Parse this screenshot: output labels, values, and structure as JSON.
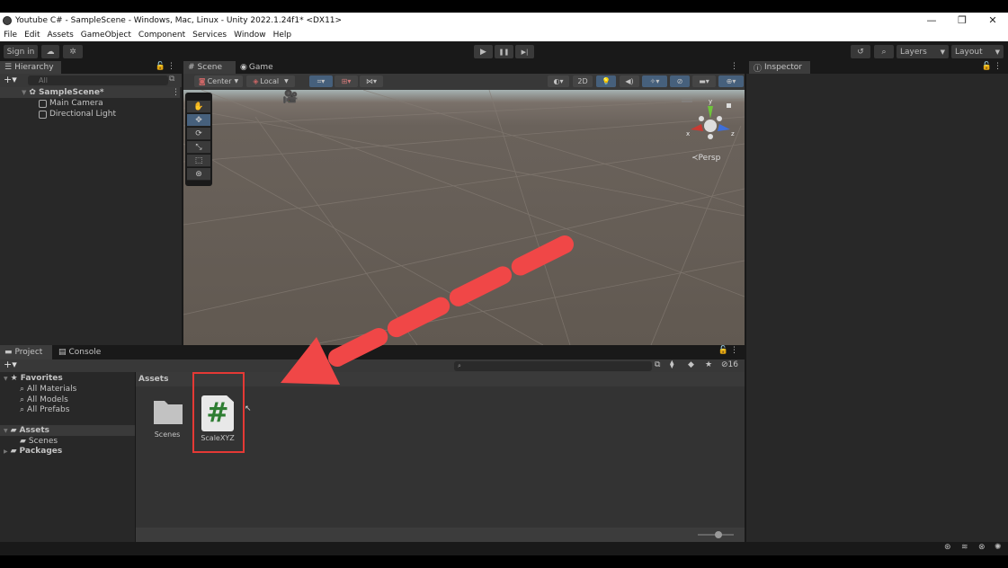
{
  "window": {
    "title": "Youtube C# - SampleScene - Windows, Mac, Linux - Unity 2022.1.24f1* <DX11>",
    "controls": {
      "minimize": "—",
      "maximize": "❐",
      "close": "✕"
    }
  },
  "menu": [
    "File",
    "Edit",
    "Assets",
    "GameObject",
    "Component",
    "Services",
    "Window",
    "Help"
  ],
  "toolbar": {
    "sign_in": "Sign in",
    "cloud_icon": "cloud-icon",
    "collab_icon": "collab-icon",
    "play": "▶",
    "pause": "❚❚",
    "step": "▶|",
    "history_icon": "history-icon",
    "search_icon": "search-icon",
    "layers": "Layers",
    "layout": "Layout"
  },
  "hierarchy": {
    "tab": "Hierarchy",
    "add": "+▾",
    "search_placeholder": "All",
    "scene": "SampleScene*",
    "items": [
      "Main Camera",
      "Directional Light"
    ]
  },
  "scene_view": {
    "tabs": [
      "Scene",
      "Game"
    ],
    "pivot": "Center",
    "space": "Local",
    "mode_2d": "2D",
    "persp": "Persp",
    "gizmo_axes": {
      "x": "x",
      "y": "y",
      "z": "z"
    }
  },
  "inspector": {
    "tab": "Inspector"
  },
  "project": {
    "tabs": [
      "Project",
      "Console"
    ],
    "add": "+▾",
    "favorites": {
      "label": "Favorites",
      "items": [
        "All Materials",
        "All Models",
        "All Prefabs"
      ]
    },
    "assets_label": "Assets",
    "scenes_label": "Scenes",
    "packages_label": "Packages",
    "breadcrumb": "Assets",
    "hidden_count": "16",
    "grid_items": [
      {
        "name": "Scenes",
        "type": "folder"
      },
      {
        "name": "ScaleXYZ",
        "type": "csharp-script",
        "glyph": "#"
      }
    ]
  },
  "annotation": {
    "color": "#f04747",
    "highlight_color": "#e53935"
  },
  "colors": {
    "script_hash": "#2e7d32",
    "accent_blue": "#46607c"
  }
}
